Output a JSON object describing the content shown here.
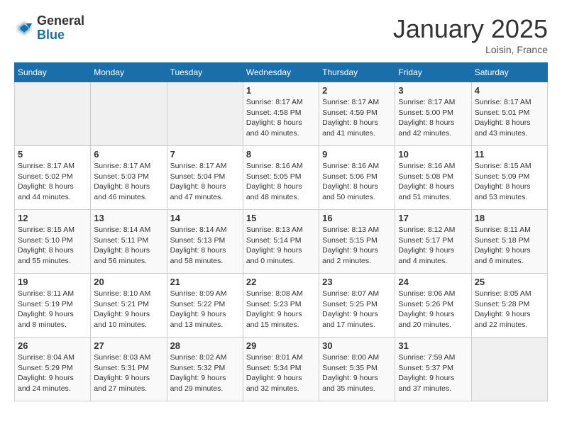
{
  "header": {
    "logo_general": "General",
    "logo_blue": "Blue",
    "month": "January 2025",
    "location": "Loisin, France"
  },
  "days_of_week": [
    "Sunday",
    "Monday",
    "Tuesday",
    "Wednesday",
    "Thursday",
    "Friday",
    "Saturday"
  ],
  "weeks": [
    [
      {
        "day": "",
        "info": ""
      },
      {
        "day": "",
        "info": ""
      },
      {
        "day": "",
        "info": ""
      },
      {
        "day": "1",
        "sunrise": "8:17 AM",
        "sunset": "4:58 PM",
        "daylight": "8 hours and 40 minutes."
      },
      {
        "day": "2",
        "sunrise": "8:17 AM",
        "sunset": "4:59 PM",
        "daylight": "8 hours and 41 minutes."
      },
      {
        "day": "3",
        "sunrise": "8:17 AM",
        "sunset": "5:00 PM",
        "daylight": "8 hours and 42 minutes."
      },
      {
        "day": "4",
        "sunrise": "8:17 AM",
        "sunset": "5:01 PM",
        "daylight": "8 hours and 43 minutes."
      }
    ],
    [
      {
        "day": "5",
        "sunrise": "8:17 AM",
        "sunset": "5:02 PM",
        "daylight": "8 hours and 44 minutes."
      },
      {
        "day": "6",
        "sunrise": "8:17 AM",
        "sunset": "5:03 PM",
        "daylight": "8 hours and 46 minutes."
      },
      {
        "day": "7",
        "sunrise": "8:17 AM",
        "sunset": "5:04 PM",
        "daylight": "8 hours and 47 minutes."
      },
      {
        "day": "8",
        "sunrise": "8:16 AM",
        "sunset": "5:05 PM",
        "daylight": "8 hours and 48 minutes."
      },
      {
        "day": "9",
        "sunrise": "8:16 AM",
        "sunset": "5:06 PM",
        "daylight": "8 hours and 50 minutes."
      },
      {
        "day": "10",
        "sunrise": "8:16 AM",
        "sunset": "5:08 PM",
        "daylight": "8 hours and 51 minutes."
      },
      {
        "day": "11",
        "sunrise": "8:15 AM",
        "sunset": "5:09 PM",
        "daylight": "8 hours and 53 minutes."
      }
    ],
    [
      {
        "day": "12",
        "sunrise": "8:15 AM",
        "sunset": "5:10 PM",
        "daylight": "8 hours and 55 minutes."
      },
      {
        "day": "13",
        "sunrise": "8:14 AM",
        "sunset": "5:11 PM",
        "daylight": "8 hours and 56 minutes."
      },
      {
        "day": "14",
        "sunrise": "8:14 AM",
        "sunset": "5:13 PM",
        "daylight": "8 hours and 58 minutes."
      },
      {
        "day": "15",
        "sunrise": "8:13 AM",
        "sunset": "5:14 PM",
        "daylight": "9 hours and 0 minutes."
      },
      {
        "day": "16",
        "sunrise": "8:13 AM",
        "sunset": "5:15 PM",
        "daylight": "9 hours and 2 minutes."
      },
      {
        "day": "17",
        "sunrise": "8:12 AM",
        "sunset": "5:17 PM",
        "daylight": "9 hours and 4 minutes."
      },
      {
        "day": "18",
        "sunrise": "8:11 AM",
        "sunset": "5:18 PM",
        "daylight": "9 hours and 6 minutes."
      }
    ],
    [
      {
        "day": "19",
        "sunrise": "8:11 AM",
        "sunset": "5:19 PM",
        "daylight": "9 hours and 8 minutes."
      },
      {
        "day": "20",
        "sunrise": "8:10 AM",
        "sunset": "5:21 PM",
        "daylight": "9 hours and 10 minutes."
      },
      {
        "day": "21",
        "sunrise": "8:09 AM",
        "sunset": "5:22 PM",
        "daylight": "9 hours and 13 minutes."
      },
      {
        "day": "22",
        "sunrise": "8:08 AM",
        "sunset": "5:23 PM",
        "daylight": "9 hours and 15 minutes."
      },
      {
        "day": "23",
        "sunrise": "8:07 AM",
        "sunset": "5:25 PM",
        "daylight": "9 hours and 17 minutes."
      },
      {
        "day": "24",
        "sunrise": "8:06 AM",
        "sunset": "5:26 PM",
        "daylight": "9 hours and 20 minutes."
      },
      {
        "day": "25",
        "sunrise": "8:05 AM",
        "sunset": "5:28 PM",
        "daylight": "9 hours and 22 minutes."
      }
    ],
    [
      {
        "day": "26",
        "sunrise": "8:04 AM",
        "sunset": "5:29 PM",
        "daylight": "9 hours and 24 minutes."
      },
      {
        "day": "27",
        "sunrise": "8:03 AM",
        "sunset": "5:31 PM",
        "daylight": "9 hours and 27 minutes."
      },
      {
        "day": "28",
        "sunrise": "8:02 AM",
        "sunset": "5:32 PM",
        "daylight": "9 hours and 29 minutes."
      },
      {
        "day": "29",
        "sunrise": "8:01 AM",
        "sunset": "5:34 PM",
        "daylight": "9 hours and 32 minutes."
      },
      {
        "day": "30",
        "sunrise": "8:00 AM",
        "sunset": "5:35 PM",
        "daylight": "9 hours and 35 minutes."
      },
      {
        "day": "31",
        "sunrise": "7:59 AM",
        "sunset": "5:37 PM",
        "daylight": "9 hours and 37 minutes."
      },
      {
        "day": "",
        "info": ""
      }
    ]
  ]
}
